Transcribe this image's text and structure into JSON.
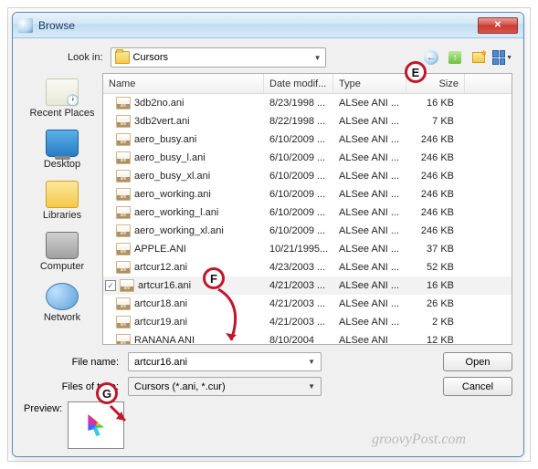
{
  "window": {
    "title": "Browse"
  },
  "lookin": {
    "label": "Look in:",
    "value": "Cursors"
  },
  "columns": {
    "name": "Name",
    "date": "Date modif...",
    "type": "Type",
    "size": "Size"
  },
  "places": {
    "recent": "Recent Places",
    "desktop": "Desktop",
    "libraries": "Libraries",
    "computer": "Computer",
    "network": "Network"
  },
  "files": [
    {
      "name": "3db2no.ani",
      "date": "8/23/1998 ...",
      "type": "ALSee ANI ...",
      "size": "16 KB",
      "selected": false
    },
    {
      "name": "3db2vert.ani",
      "date": "8/22/1998 ...",
      "type": "ALSee ANI ...",
      "size": "7 KB",
      "selected": false
    },
    {
      "name": "aero_busy.ani",
      "date": "6/10/2009 ...",
      "type": "ALSee ANI ...",
      "size": "246 KB",
      "selected": false
    },
    {
      "name": "aero_busy_l.ani",
      "date": "6/10/2009 ...",
      "type": "ALSee ANI ...",
      "size": "246 KB",
      "selected": false
    },
    {
      "name": "aero_busy_xl.ani",
      "date": "6/10/2009 ...",
      "type": "ALSee ANI ...",
      "size": "246 KB",
      "selected": false
    },
    {
      "name": "aero_working.ani",
      "date": "6/10/2009 ...",
      "type": "ALSee ANI ...",
      "size": "246 KB",
      "selected": false
    },
    {
      "name": "aero_working_l.ani",
      "date": "6/10/2009 ...",
      "type": "ALSee ANI ...",
      "size": "246 KB",
      "selected": false
    },
    {
      "name": "aero_working_xl.ani",
      "date": "6/10/2009 ...",
      "type": "ALSee ANI ...",
      "size": "246 KB",
      "selected": false
    },
    {
      "name": "APPLE.ANI",
      "date": "10/21/1995...",
      "type": "ALSee ANI ...",
      "size": "37 KB",
      "selected": false
    },
    {
      "name": "artcur12.ani",
      "date": "4/23/2003 ...",
      "type": "ALSee ANI ...",
      "size": "52 KB",
      "selected": false
    },
    {
      "name": "artcur16.ani",
      "date": "4/21/2003 ...",
      "type": "ALSee ANI ...",
      "size": "16 KB",
      "selected": true
    },
    {
      "name": "artcur18.ani",
      "date": "4/21/2003 ...",
      "type": "ALSee ANI ...",
      "size": "26 KB",
      "selected": false
    },
    {
      "name": "artcur19.ani",
      "date": "4/21/2003 ...",
      "type": "ALSee ANI ...",
      "size": "2 KB",
      "selected": false
    },
    {
      "name": "RANANA ANI",
      "date": "8/10/2004",
      "type": "ALSee ANI",
      "size": "12 KB",
      "selected": false
    }
  ],
  "filename": {
    "label": "File name:",
    "value": "artcur16.ani"
  },
  "filetype": {
    "label": "Files of type:",
    "value": "Cursors (*.ani, *.cur)"
  },
  "buttons": {
    "open": "Open",
    "cancel": "Cancel"
  },
  "preview": {
    "label": "Preview:"
  },
  "markers": {
    "e": "E",
    "f": "F",
    "g": "G"
  },
  "watermark": "groovyPost.com"
}
